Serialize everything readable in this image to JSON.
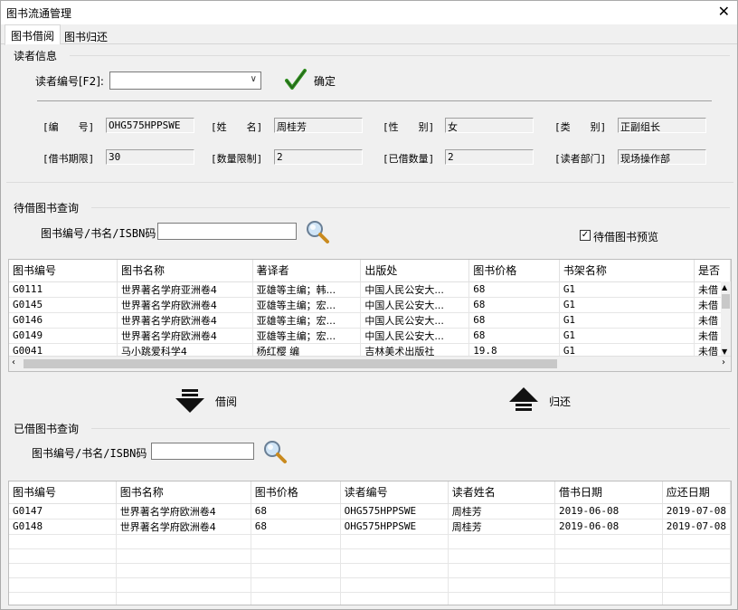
{
  "window": {
    "title": "图书流通管理",
    "close_glyph": "✕"
  },
  "tabs": [
    {
      "label": "图书借阅"
    },
    {
      "label": "图书归还"
    }
  ],
  "reader": {
    "section_title": "读者信息",
    "id_label": "读者编号[F2]:",
    "id_value": "",
    "confirm_label": "确定",
    "fields": {
      "number_label": "[编　　号]",
      "number_value": "OHG575HPPSWE",
      "name_label": "[姓　　名]",
      "name_value": "周桂芳",
      "gender_label": "[性　　别]",
      "gender_value": "女",
      "type_label": "[类　　别]",
      "type_value": "正副组长",
      "period_label": "[借书期限]",
      "period_value": "30",
      "limit_label": "[数量限制]",
      "limit_value": "2",
      "borrowed_label": "[已借数量]",
      "borrowed_value": "2",
      "dept_label": "[读者部门]",
      "dept_value": "现场操作部"
    }
  },
  "pending": {
    "section_title": "待借图书查询",
    "search_label": "图书编号/书名/ISBN码",
    "search_value": "",
    "preview_label": "待借图书预览",
    "preview_checked": "✓",
    "columns": [
      "图书编号",
      "图书名称",
      "著译者",
      "出版处",
      "图书价格",
      "书架名称",
      "是否"
    ],
    "rows": [
      [
        "G0111",
        "世界著名学府亚洲卷4",
        "亚雄等主编；韩...",
        "中国人民公安大...",
        "68",
        "G1",
        "未借"
      ],
      [
        "G0145",
        "世界著名学府欧洲卷4",
        "亚雄等主编；宏...",
        "中国人民公安大...",
        "68",
        "G1",
        "未借"
      ],
      [
        "G0146",
        "世界著名学府欧洲卷4",
        "亚雄等主编；宏...",
        "中国人民公安大...",
        "68",
        "G1",
        "未借"
      ],
      [
        "G0149",
        "世界著名学府欧洲卷4",
        "亚雄等主编；宏...",
        "中国人民公安大...",
        "68",
        "G1",
        "未借"
      ],
      [
        "G0041",
        "马小跳爱科学4",
        "杨红樱 编",
        "吉林美术出版社",
        "19.8",
        "G1",
        "未借"
      ]
    ]
  },
  "actions": {
    "borrow_label": "借阅",
    "return_label": "归还"
  },
  "borrowed": {
    "section_title": "已借图书查询",
    "search_label": "图书编号/书名/ISBN码",
    "search_value": "",
    "columns": [
      "图书编号",
      "图书名称",
      "图书价格",
      "读者编号",
      "读者姓名",
      "借书日期",
      "应还日期"
    ],
    "rows": [
      [
        "G0147",
        "世界著名学府欧洲卷4",
        "68",
        "OHG575HPPSWE",
        "周桂芳",
        "2019-06-08",
        "2019-07-08"
      ],
      [
        "G0148",
        "世界著名学府欧洲卷4",
        "68",
        "OHG575HPPSWE",
        "周桂芳",
        "2019-06-08",
        "2019-07-08"
      ]
    ]
  }
}
